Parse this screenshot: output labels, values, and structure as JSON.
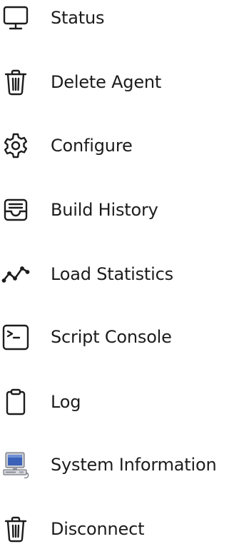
{
  "menu": {
    "items": [
      {
        "id": "status",
        "label": "Status",
        "icon": "monitor-icon"
      },
      {
        "id": "delete-agent",
        "label": "Delete Agent",
        "icon": "trash-icon"
      },
      {
        "id": "configure",
        "label": "Configure",
        "icon": "gear-icon"
      },
      {
        "id": "build-history",
        "label": "Build History",
        "icon": "inbox-icon"
      },
      {
        "id": "load-statistics",
        "label": "Load Statistics",
        "icon": "line-chart-icon"
      },
      {
        "id": "script-console",
        "label": "Script Console",
        "icon": "terminal-icon"
      },
      {
        "id": "log",
        "label": "Log",
        "icon": "clipboard-icon"
      },
      {
        "id": "system-information",
        "label": "System Information",
        "icon": "computer-icon"
      },
      {
        "id": "disconnect",
        "label": "Disconnect",
        "icon": "trash-icon"
      }
    ]
  },
  "colors": {
    "text": "#1c1c1c",
    "icon_stroke": "#1c1c1c",
    "background": "#ffffff"
  }
}
